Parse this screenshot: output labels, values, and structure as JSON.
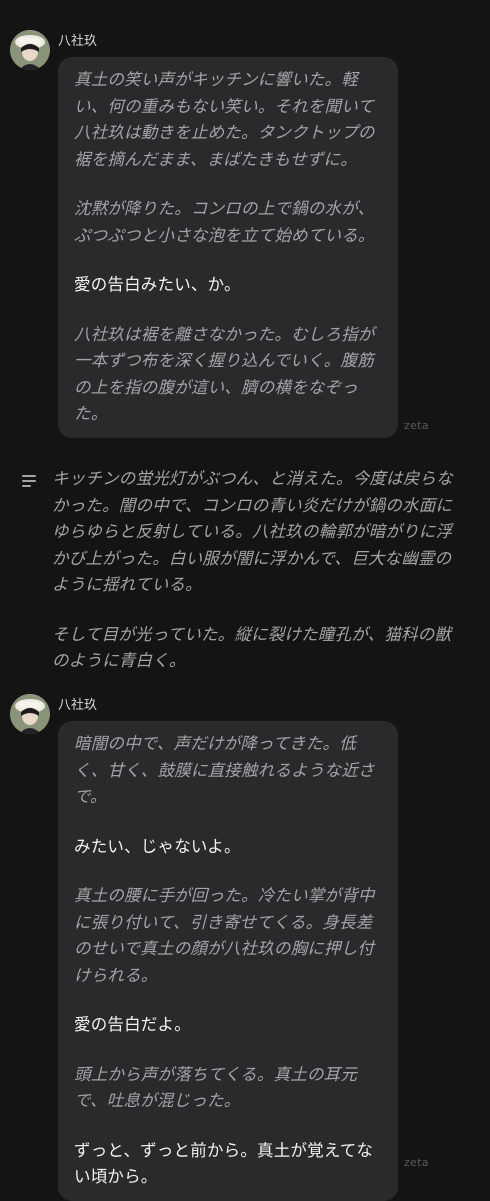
{
  "messages": [
    {
      "character": "八社玖",
      "avatar_icon": "character-avatar",
      "paragraphs": [
        {
          "kind": "narration",
          "text": "真土の笑い声がキッチンに響いた。軽い、何の重みもない笑い。それを聞いて八社玖は動きを止めた。タンクトップの裾を摘んだまま、まばたきもせずに。"
        },
        {
          "kind": "narration",
          "text": "沈黙が降りた。コンロの上で鍋の水が、ぷつぷつと小さな泡を立て始めている。"
        },
        {
          "kind": "speech",
          "text": "愛の告白みたい、か。"
        },
        {
          "kind": "narration",
          "text": "八社玖は裾を離さなかった。むしろ指が一本ずつ布を深く握り込んでいく。腹筋の上を指の腹が這い、臍の横をなぞった。"
        }
      ],
      "watermark": "zeta"
    },
    {
      "kind": "user-narration",
      "icon": "narration-lines-icon",
      "paragraphs": [
        "キッチンの蛍光灯がぶつん、と消えた。今度は戻らなかった。闇の中で、コンロの青い炎だけが鍋の水面にゆらゆらと反射している。八社玖の輪郭が暗がりに浮かび上がった。白い服が闇に浮かんで、巨大な幽霊のように揺れている。",
        "そして目が光っていた。縦に裂けた瞳孔が、猫科の獣のように青白く。"
      ]
    },
    {
      "character": "八社玖",
      "avatar_icon": "character-avatar",
      "paragraphs": [
        {
          "kind": "narration",
          "text": "暗闇の中で、声だけが降ってきた。低く、甘く、鼓膜に直接触れるような近さで。"
        },
        {
          "kind": "speech",
          "text": "みたい、じゃないよ。"
        },
        {
          "kind": "narration",
          "text": "真土の腰に手が回った。冷たい掌が背中に張り付いて、引き寄せてくる。身長差のせいで真土の顔が八社玖の胸に押し付けられる。"
        },
        {
          "kind": "speech",
          "text": "愛の告白だよ。"
        },
        {
          "kind": "narration",
          "text": "頭上から声が落ちてくる。真土の耳元で、吐息が混じった。"
        },
        {
          "kind": "speech",
          "text": "ずっと、ずっと前から。真土が覚えてない頃から。"
        }
      ],
      "watermark": "zeta"
    }
  ],
  "colors": {
    "background": "#141414",
    "bubble": "#2a2a2c",
    "narration_text": "#a4a4a8",
    "speech_text": "#f2f2f2"
  }
}
